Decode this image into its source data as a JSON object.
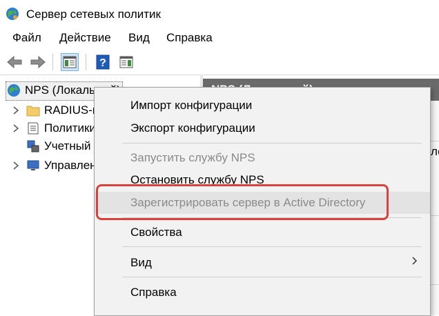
{
  "window": {
    "title": "Сервер сетевых политик",
    "icon": "nps-globe-icon"
  },
  "menu": [
    "Файл",
    "Действие",
    "Вид",
    "Справка"
  ],
  "toolbar": {
    "icons": [
      "back-arrow-icon",
      "forward-arrow-icon",
      "show-hide-tree-icon",
      "help-icon",
      "properties-pane-icon"
    ]
  },
  "tree": {
    "root": {
      "label": "NPS (Локальный)",
      "icon": "nps-globe-icon"
    },
    "items": [
      {
        "label": "RADIUS-клиенты и серверы",
        "icon": "folder-icon",
        "expandable": true
      },
      {
        "label": "Политики",
        "icon": "policy-document-icon",
        "expandable": true
      },
      {
        "label": "Учетный",
        "icon": "accounting-icon",
        "expandable": false
      },
      {
        "label": "Управление шаблонами",
        "icon": "computer-icon",
        "expandable": true
      }
    ]
  },
  "right_pane": {
    "header": "NPS (Локальный)",
    "fragment": "ло"
  },
  "context_menu": {
    "items": [
      {
        "label": "Импорт конфигурации",
        "enabled": true
      },
      {
        "label": "Экспорт конфигурации",
        "enabled": true
      },
      {
        "label": "Запустить службу NPS",
        "enabled": false
      },
      {
        "label": "Остановить службу NPS",
        "enabled": true
      },
      {
        "label": "Зарегистрировать сервер в Active Directory",
        "enabled": false,
        "highlighted": true
      },
      {
        "label": "Свойства",
        "enabled": true
      },
      {
        "label": "Вид",
        "enabled": true,
        "submenu": true
      },
      {
        "label": "Справка",
        "enabled": true
      }
    ]
  },
  "colors": {
    "highlight_border": "#d9413a",
    "menu_bg": "#f2f2f2",
    "disabled_text": "#8a8a8a"
  }
}
